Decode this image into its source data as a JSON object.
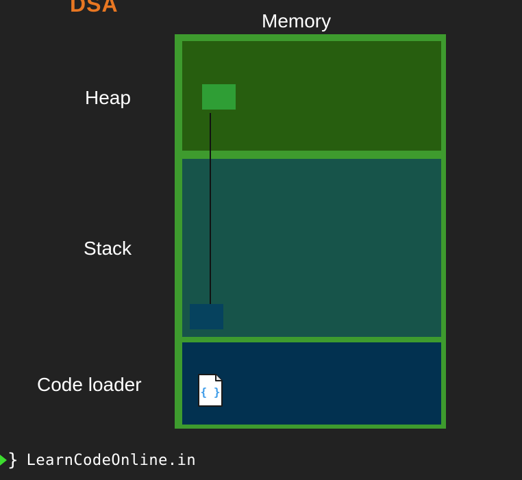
{
  "brand": {
    "top_text": "DSA",
    "footer_brace": "}",
    "footer_text": "LearnCodeOnline.in"
  },
  "diagram": {
    "title": "Memory",
    "regions": [
      {
        "label": "Heap",
        "color": "#275E0F"
      },
      {
        "label": "Stack",
        "color": "#17544A"
      },
      {
        "label": "Code loader",
        "color": "#023150"
      }
    ],
    "frame_color": "#3E9B2E",
    "heap_block_color": "#2F9E35",
    "stack_block_color": "#06425E",
    "code_icon": "file-code-icon",
    "code_icon_text": "{ }"
  },
  "colors": {
    "background": "#222222",
    "brand_accent": "#E87722",
    "footer_arrow": "#3DDC2F"
  }
}
